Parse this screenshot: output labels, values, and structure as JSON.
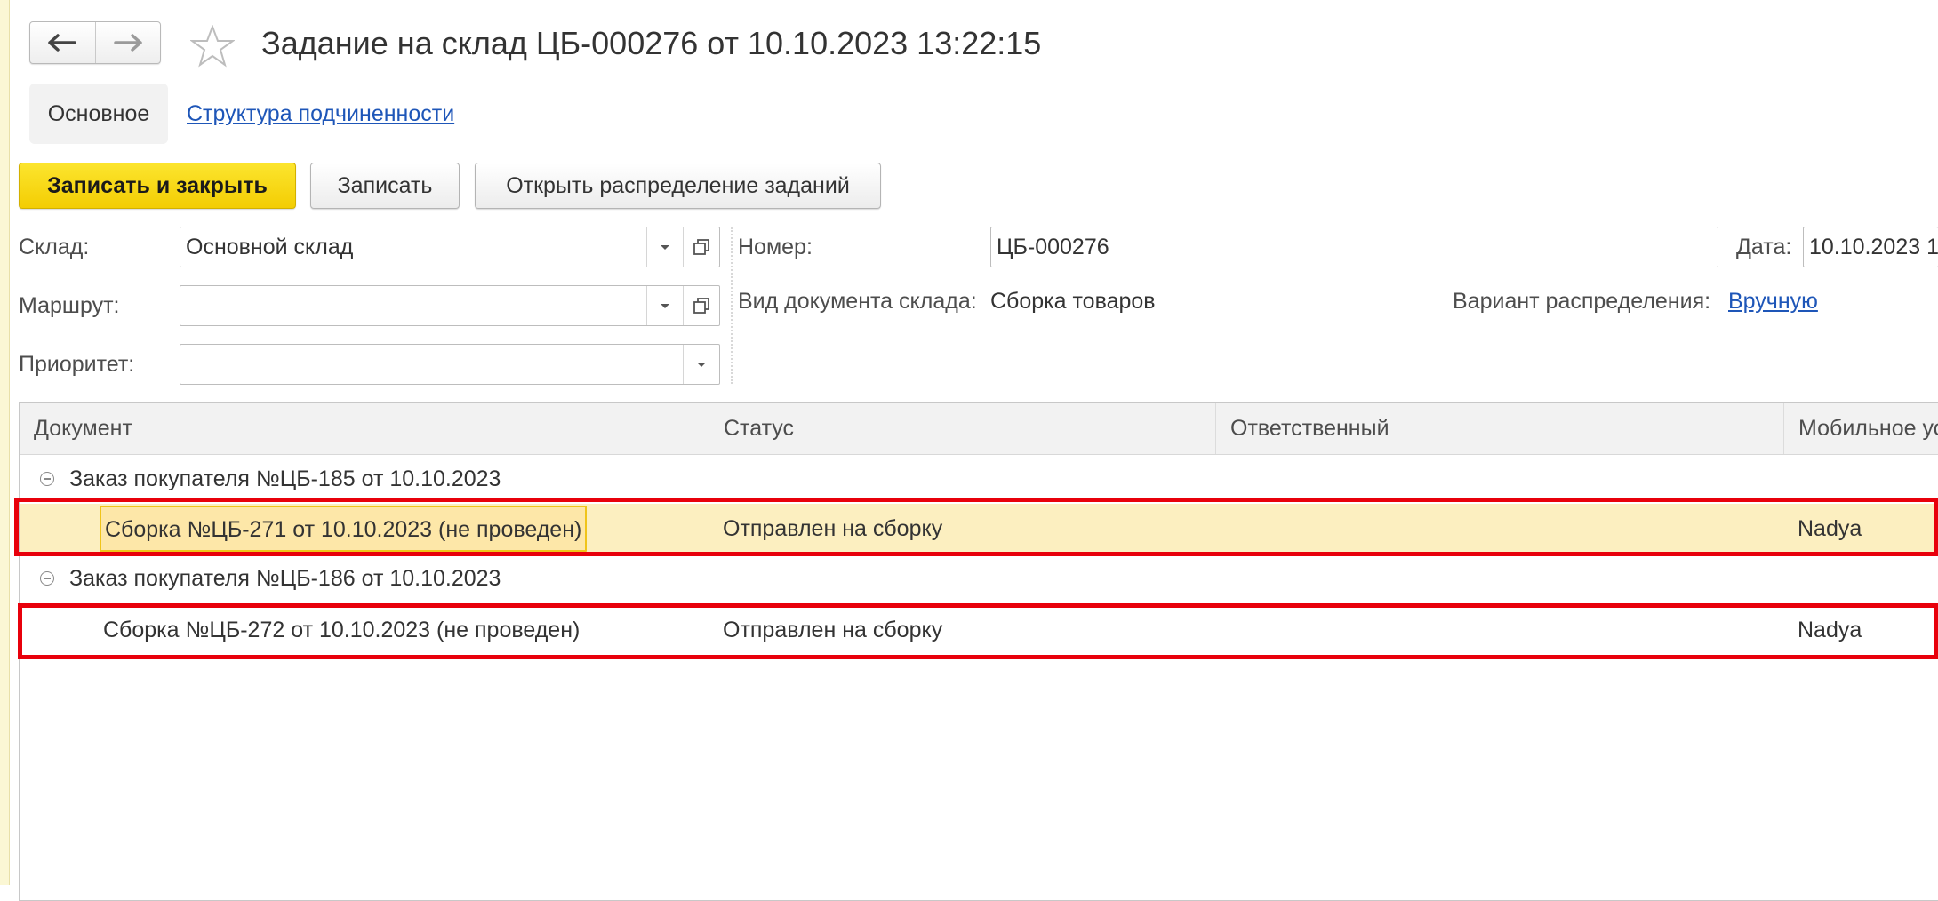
{
  "window": {
    "title": "Задание на склад ЦБ-000276 от 10.10.2023 13:22:15"
  },
  "tabs": [
    {
      "label": "Основное",
      "active": true
    },
    {
      "label": "Структура подчиненности",
      "active": false
    }
  ],
  "toolbar": {
    "save_close_label": "Записать и закрыть",
    "save_label": "Записать",
    "open_distribution_label": "Открыть распределение заданий"
  },
  "form": {
    "warehouse_label": "Склад:",
    "warehouse_value": "Основной склад",
    "route_label": "Маршрут:",
    "route_value": "",
    "priority_label": "Приоритет:",
    "priority_value": "",
    "number_label": "Номер:",
    "number_value": "ЦБ-000276",
    "date_label": "Дата:",
    "date_value": "10.10.2023 1",
    "doc_type_label": "Вид документа склада:",
    "doc_type_value": "Сборка товаров",
    "distribution_label": "Вариант распределения:",
    "distribution_value": "Вручную"
  },
  "table": {
    "columns": [
      "Документ",
      "Статус",
      "Ответственный",
      "Мобильное ус"
    ],
    "groups": [
      {
        "label": "Заказ покупателя №ЦБ-185 от 10.10.2023",
        "rows": [
          {
            "document": "Сборка №ЦБ-271 от 10.10.2023 (не проведен)",
            "status": "Отправлен на сборку",
            "responsible": "",
            "mobile": "Nadya"
          }
        ]
      },
      {
        "label": "Заказ покупателя №ЦБ-186 от 10.10.2023",
        "rows": [
          {
            "document": "Сборка №ЦБ-272 от 10.10.2023 (не проведен)",
            "status": "Отправлен на сборку",
            "responsible": "",
            "mobile": "Nadya"
          }
        ]
      }
    ]
  },
  "colors": {
    "primary_button": "#f5d20a",
    "link": "#1e56b8",
    "selected_row": "#fcefc0",
    "highlight_frame": "#e8000b"
  }
}
